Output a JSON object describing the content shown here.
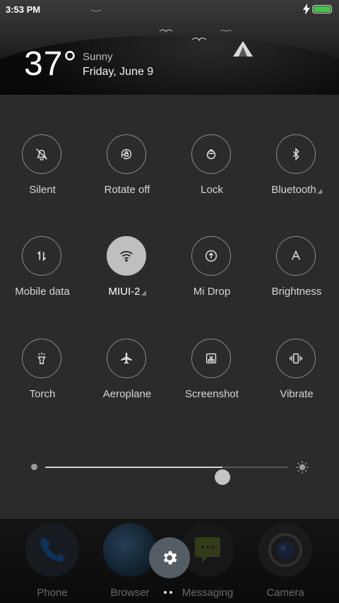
{
  "status_bar": {
    "time": "3:53 PM",
    "charging_icon": "bolt-icon",
    "battery_icon": "battery-icon"
  },
  "weather": {
    "temperature": "37°",
    "condition": "Sunny",
    "date": "Friday, June 9"
  },
  "tiles": [
    {
      "label": "Silent",
      "icon": "bell-off-icon",
      "active": false
    },
    {
      "label": "Rotate off",
      "icon": "rotate-lock-icon",
      "active": false
    },
    {
      "label": "Lock",
      "icon": "lock-icon",
      "active": false
    },
    {
      "label": "Bluetooth",
      "icon": "bluetooth-icon",
      "active": false,
      "has_submenu": true
    },
    {
      "label": "Mobile data",
      "icon": "mobile-data-icon",
      "active": false
    },
    {
      "label": "MIUI-2",
      "icon": "wifi-icon",
      "active": true,
      "has_submenu": true
    },
    {
      "label": "Mi Drop",
      "icon": "upload-icon",
      "active": false
    },
    {
      "label": "Brightness",
      "icon": "auto-brightness-icon",
      "active": false
    },
    {
      "label": "Torch",
      "icon": "torch-icon",
      "active": false
    },
    {
      "label": "Aeroplane",
      "icon": "airplane-icon",
      "active": false
    },
    {
      "label": "Screenshot",
      "icon": "screenshot-icon",
      "active": false
    },
    {
      "label": "Vibrate",
      "icon": "vibrate-icon",
      "active": false
    }
  ],
  "brightness_slider": {
    "value": 0.73,
    "min_icon": "dim-dot-icon",
    "max_icon": "sun-icon"
  },
  "dock": {
    "apps": [
      {
        "label": "Phone",
        "icon": "phone-icon"
      },
      {
        "label": "Browser",
        "icon": "browser-icon"
      },
      {
        "label": "Messaging",
        "icon": "messaging-icon"
      },
      {
        "label": "Camera",
        "icon": "camera-icon"
      }
    ],
    "settings_icon": "gear-icon"
  },
  "colors": {
    "panel": "#2b2b2b",
    "active_tile": "#bfbfbf",
    "battery": "#46c24a"
  }
}
